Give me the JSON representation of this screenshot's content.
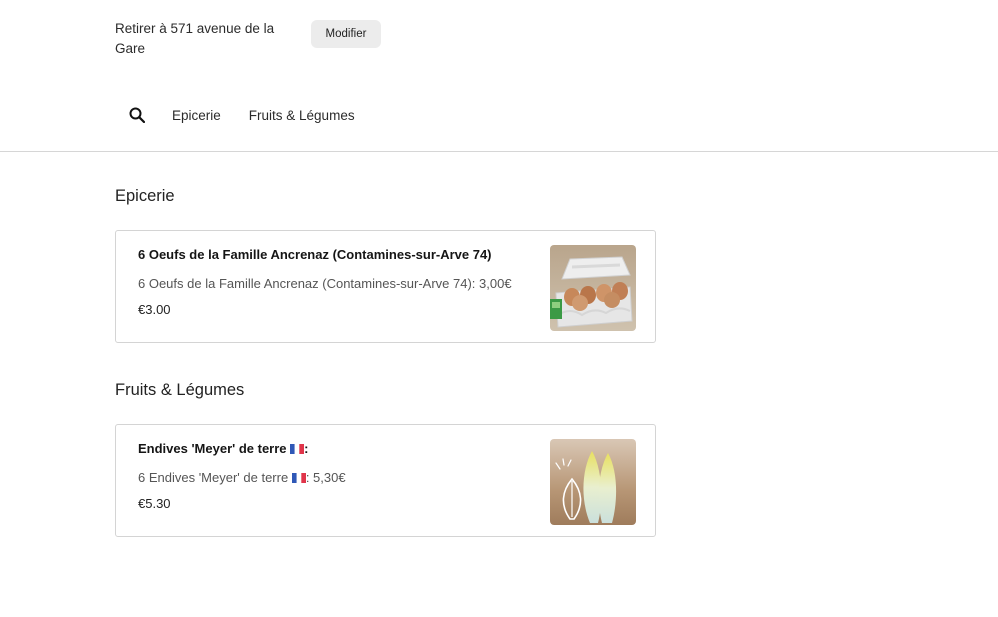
{
  "header": {
    "pickup_text": "Retirer à 571 avenue de la Gare",
    "modify_label": "Modifier"
  },
  "nav": {
    "search_icon": "search-icon",
    "links": [
      {
        "label": "Epicerie"
      },
      {
        "label": "Fruits & Légumes"
      }
    ]
  },
  "sections": [
    {
      "title": "Epicerie",
      "items": [
        {
          "title": "6 Oeufs de la Famille Ancrenaz (Contamines-sur-Arve 74)",
          "description": "6 Oeufs de la Famille Ancrenaz (Contamines-sur-Arve 74): 3,00€",
          "price": "€3.00",
          "image": "eggs-carton-image"
        }
      ]
    },
    {
      "title": "Fruits & Légumes",
      "items": [
        {
          "title_before_flag": "Endives 'Meyer' de terre ",
          "title_after_flag": ":",
          "description_before_flag": "6 Endives 'Meyer' de terre ",
          "description_after_flag": ": 5,30€",
          "price": "€5.30",
          "image": "endives-image",
          "flag_icon": "french-flag-icon"
        }
      ]
    }
  ],
  "colors": {
    "divider": "#d6d6d6",
    "button_bg": "#ececec",
    "card_border": "#d4d4d4"
  }
}
